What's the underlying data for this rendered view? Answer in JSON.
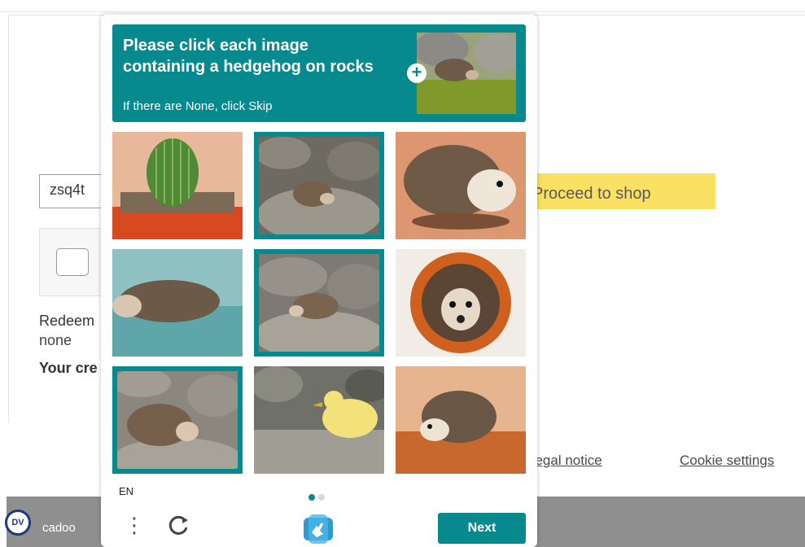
{
  "page": {
    "code_value": "zsq4t",
    "proceed_label": "Proceed to shop",
    "redeem_label": "Redeem",
    "redeem_value": "none",
    "credit_label": "Your cre",
    "footer_links": [
      "Legal notice",
      "Cookie settings"
    ],
    "bottom_bar_text": "cadoo",
    "badge_text": "DV"
  },
  "challenge": {
    "prompt_title": "Please click each image containing a hedgehog on rocks",
    "prompt_subtitle": "If there are None, click Skip",
    "language": "EN",
    "next_label": "Next",
    "accent_color": "#078a8d",
    "tiles": [
      {
        "subject": "cactus in pot",
        "selected": false
      },
      {
        "subject": "hedgehog on rocks",
        "selected": true
      },
      {
        "subject": "hedgehog on sand",
        "selected": false
      },
      {
        "subject": "hedgehog in water",
        "selected": false
      },
      {
        "subject": "hedgehog on rocks",
        "selected": true
      },
      {
        "subject": "hedgehog in pot",
        "selected": false
      },
      {
        "subject": "hedgehog on rocks",
        "selected": true
      },
      {
        "subject": "duckling on rocks",
        "selected": false
      },
      {
        "subject": "hedgehog on sand",
        "selected": false
      }
    ],
    "page_indicator": {
      "current": 1,
      "total": 2
    }
  }
}
